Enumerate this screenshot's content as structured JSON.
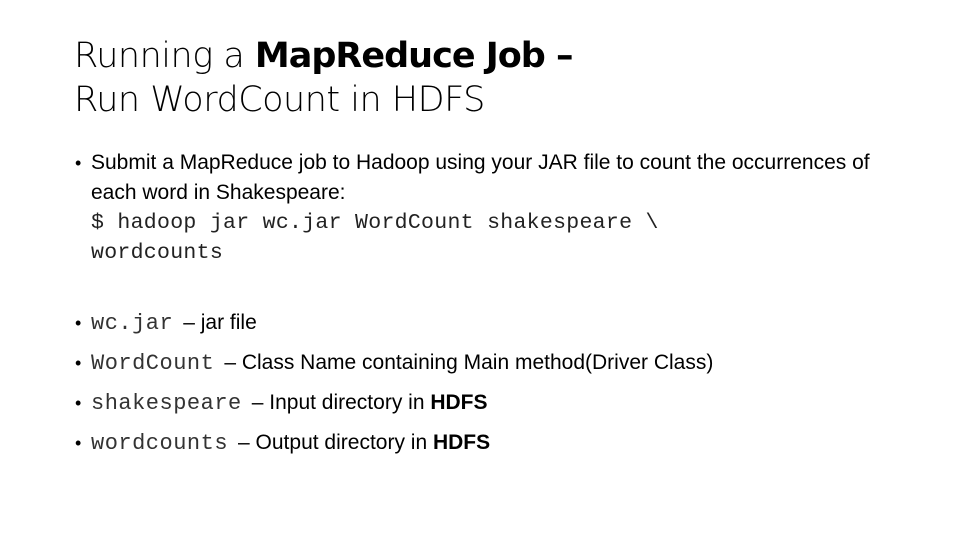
{
  "slide": {
    "title": {
      "line1_prefix": "Running a ",
      "line1_bold": "MapReduce Job –",
      "line2": "Run WordCount in HDFS"
    },
    "intro_bullet": {
      "text": "Submit a MapReduce job to Hadoop using your JAR file to count the occurrences of each word in Shakespeare:",
      "command_line1": "$ hadoop jar wc.jar WordCount shakespeare \\",
      "command_line2": "wordcounts"
    },
    "items": [
      {
        "term": "wc.jar",
        "description": "– jar file",
        "bold_suffix": ""
      },
      {
        "term": "WordCount",
        "description": "– Class Name containing Main method(Driver Class)",
        "bold_suffix": ""
      },
      {
        "term": "shakespeare",
        "description": "– Input directory in ",
        "bold_suffix": "HDFS"
      },
      {
        "term": "wordcounts",
        "description": "– Output directory in ",
        "bold_suffix": "HDFS"
      }
    ],
    "bullet_glyph": "•"
  }
}
